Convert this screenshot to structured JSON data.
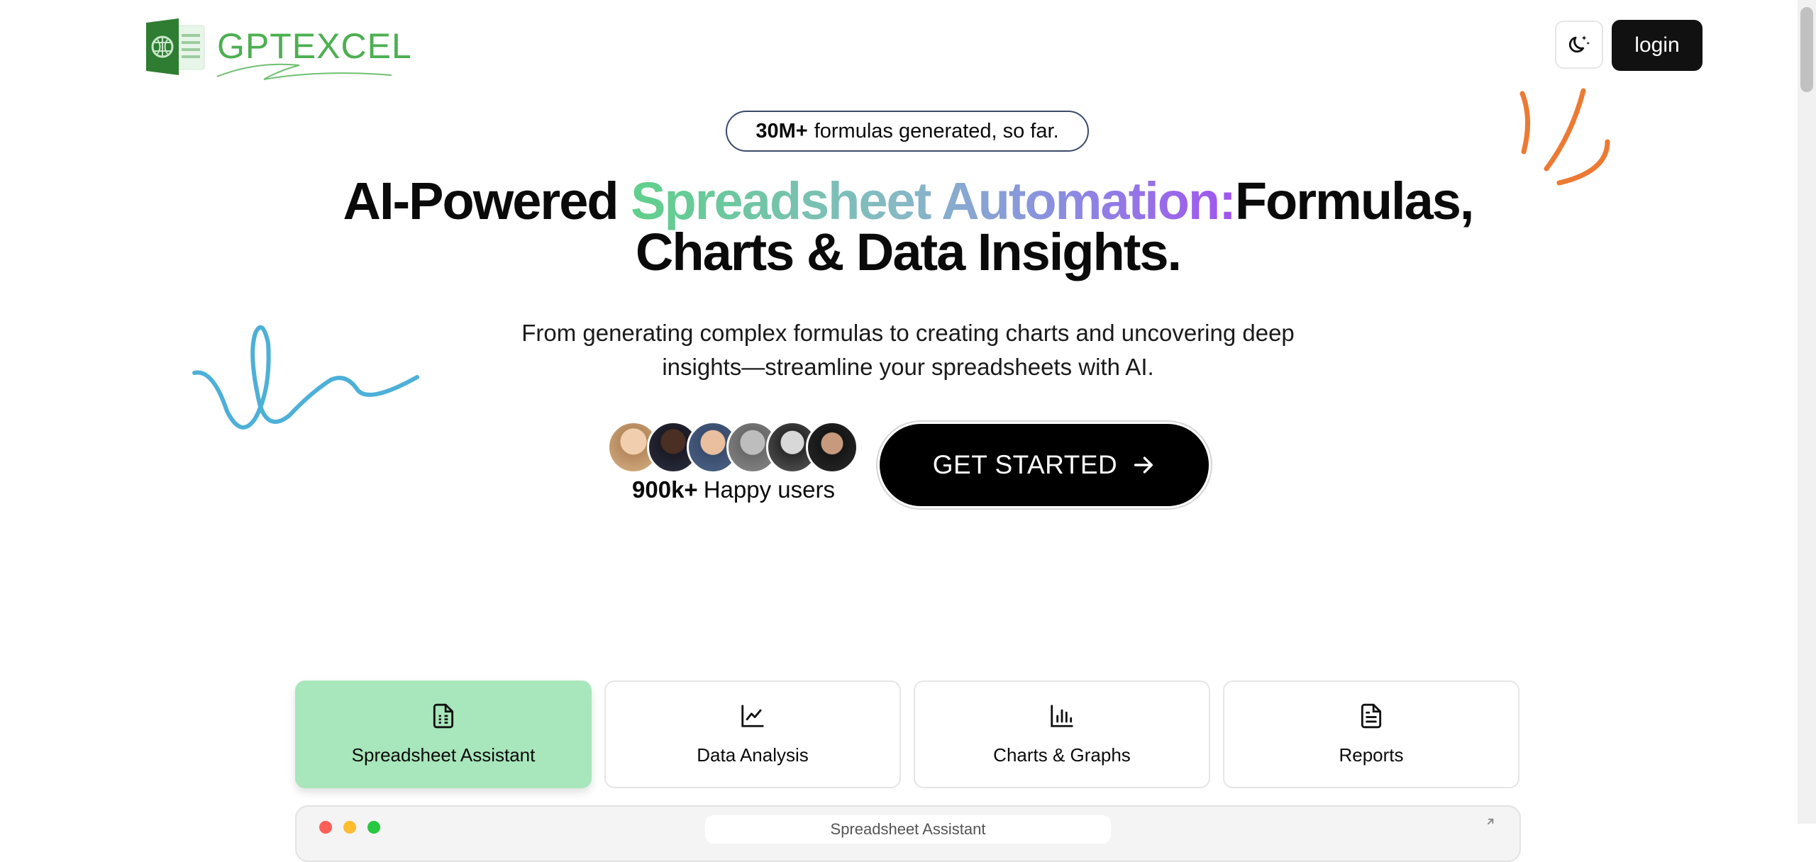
{
  "header": {
    "logo_text": "GPTEXCEL",
    "logo_icon": "excel-brain-icon",
    "theme_icon": "moon-stars-icon",
    "login_label": "login"
  },
  "hero": {
    "badge_bold": "30M+",
    "badge_text": "formulas generated, so far.",
    "headline_part1": "AI-Powered ",
    "headline_highlight": "Spreadsheet Automation:",
    "headline_part2": "Formulas, Charts & Data Insights.",
    "subtitle": "From generating complex formulas to creating charts and uncovering deep insights—streamline your spreadsheets with AI.",
    "users_count": "900k+",
    "users_label": "Happy users",
    "cta_label": "GET STARTED",
    "cta_icon": "arrow-right-icon"
  },
  "tabs": [
    {
      "label": "Spreadsheet Assistant",
      "icon": "spreadsheet-doc-icon",
      "active": true
    },
    {
      "label": "Data Analysis",
      "icon": "line-chart-icon",
      "active": false
    },
    {
      "label": "Charts & Graphs",
      "icon": "bar-chart-icon",
      "active": false
    },
    {
      "label": "Reports",
      "icon": "report-doc-icon",
      "active": false
    }
  ],
  "preview": {
    "title": "Spreadsheet Assistant"
  },
  "colors": {
    "brand_green": "#4caf50",
    "active_tab": "#a8e6bb",
    "gradient_start": "#5fd08a",
    "gradient_end": "#a154ef",
    "squiggle_blue": "#4db0d8",
    "squiggle_orange": "#ec7a33",
    "button_dark": "#111111"
  }
}
